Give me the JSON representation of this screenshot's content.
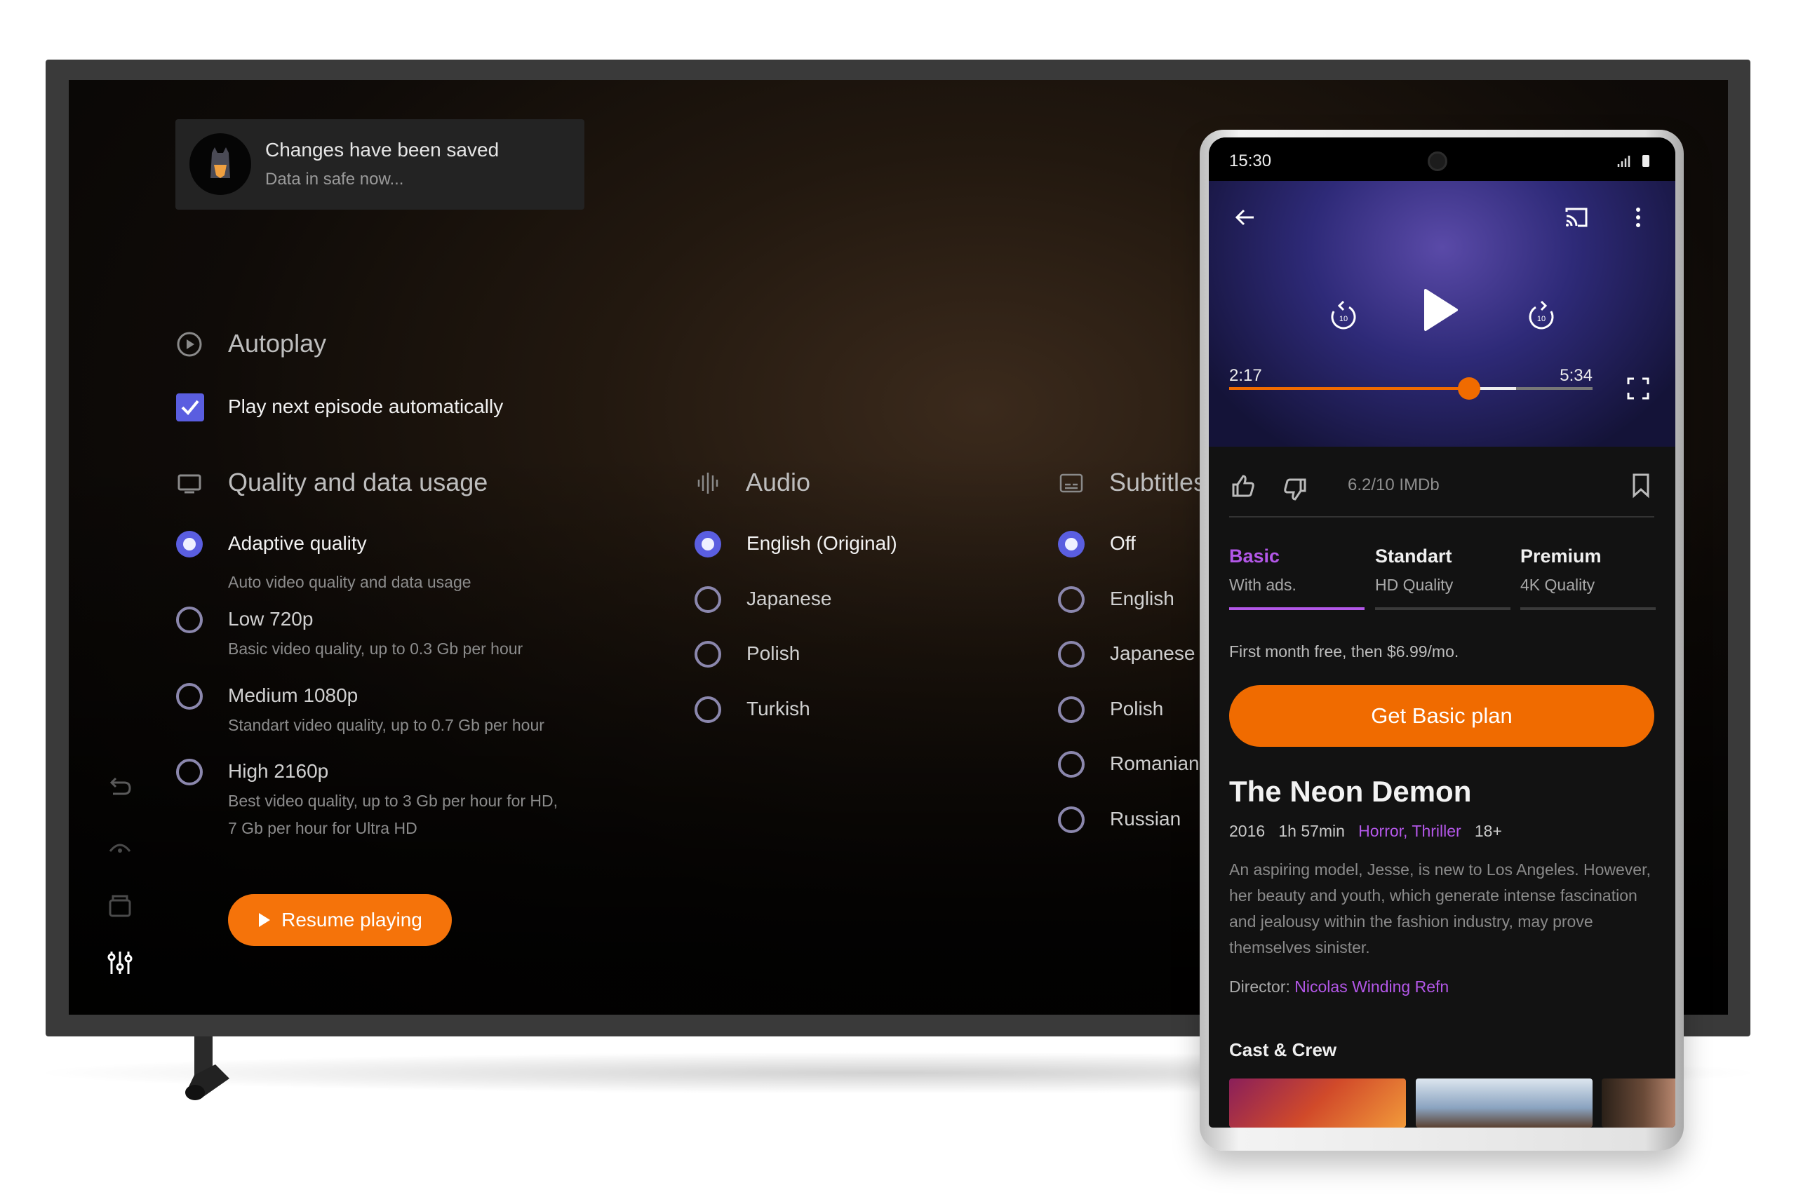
{
  "toast": {
    "title": "Changes have been saved",
    "subtitle": "Data in safe now..."
  },
  "autoplay": {
    "heading": "Autoplay",
    "checkbox_label": "Play next episode automatically",
    "checked": true
  },
  "quality": {
    "heading": "Quality and data usage",
    "options": [
      {
        "label": "Adaptive quality",
        "desc": "Auto video quality and data usage",
        "selected": true
      },
      {
        "label": "Low 720p",
        "desc": "Basic video quality, up to 0.3 Gb per hour",
        "selected": false
      },
      {
        "label": "Medium 1080p",
        "desc": "Standart video quality, up to 0.7 Gb per hour",
        "selected": false
      },
      {
        "label": "High 2160p",
        "desc": "Best video quality, up to 3 Gb per hour for HD,",
        "desc2": "7 Gb per hour for Ultra HD",
        "selected": false
      }
    ]
  },
  "audio": {
    "heading": "Audio",
    "options": [
      "English (Original)",
      "Japanese",
      "Polish",
      "Turkish"
    ],
    "selected": "English (Original)"
  },
  "subtitles": {
    "heading": "Subtitles",
    "options": [
      "Off",
      "English",
      "Japanese",
      "Polish",
      "Romanian",
      "Russian"
    ],
    "selected": "Off"
  },
  "resume_label": "Resume playing",
  "sidebar": [
    "back-icon",
    "eye-icon",
    "library-icon",
    "settings-sliders-icon"
  ],
  "colors": {
    "accent": "#f5730a",
    "radio": "#5a5ee0",
    "purple": "#b357e8"
  },
  "phone": {
    "time": "15:30",
    "player": {
      "current": "2:17",
      "duration": "5:34",
      "progress": 0.66,
      "buffered": 0.79,
      "skip": "10"
    },
    "rating": "6.2/10 IMDb",
    "plans": [
      {
        "name": "Basic",
        "desc": "With ads.",
        "selected": true
      },
      {
        "name": "Standart",
        "desc": "HD Quality"
      },
      {
        "name": "Premium",
        "desc": "4K Quality"
      }
    ],
    "price_note": "First month free, then $6.99/mo.",
    "cta": "Get Basic plan",
    "movie": {
      "title": "The Neon Demon",
      "year": "2016",
      "duration": "1h 57min",
      "genres": "Horror, Thriller",
      "age": "18+",
      "description": "An aspiring model, Jesse, is new to Los Angeles. However, her beauty and youth, which generate intense fascination and jealousy within the fashion industry, may prove themselves sinister.",
      "director_label": "Director:",
      "director": "Nicolas Winding Refn"
    },
    "cast_heading": "Cast & Crew"
  }
}
